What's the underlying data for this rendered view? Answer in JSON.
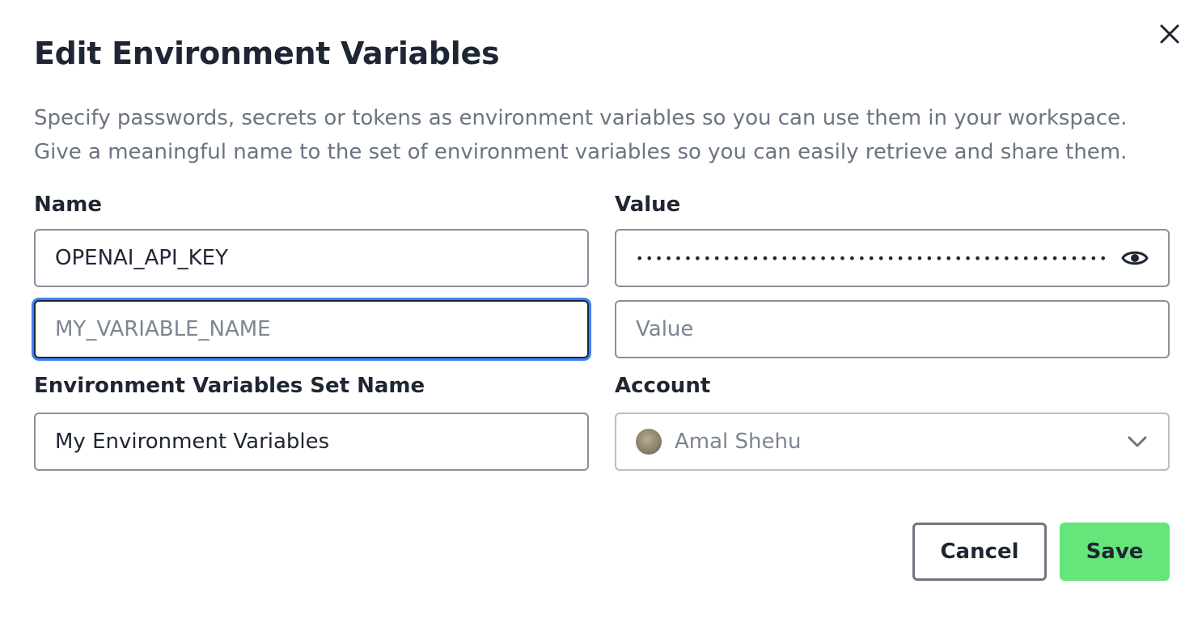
{
  "dialog": {
    "title": "Edit Environment Variables",
    "description": [
      "Specify passwords, secrets or tokens as environment variables so you can use them in your workspace.",
      "Give a meaningful name to the set of environment variables so you can easily retrieve and share them."
    ]
  },
  "variables": {
    "name_label": "Name",
    "value_label": "Value",
    "rows": [
      {
        "name": "OPENAI_API_KEY",
        "value_masked": "••••••••••••••••••••••••••••••••••••••••••••••••••••"
      },
      {
        "name": "",
        "name_placeholder": "MY_VARIABLE_NAME",
        "value": "",
        "value_placeholder": "Value"
      }
    ]
  },
  "set": {
    "label": "Environment Variables Set Name",
    "value": "My Environment Variables"
  },
  "account": {
    "label": "Account",
    "selected": "Amal Shehu"
  },
  "actions": {
    "cancel": "Cancel",
    "save": "Save"
  },
  "colors": {
    "text": "#1f2633",
    "muted": "#6b7482",
    "focus": "#3b82f6",
    "save_bg": "#65e57a"
  },
  "icons": [
    "close-icon",
    "eye-icon",
    "avatar",
    "chevron-down-icon"
  ]
}
